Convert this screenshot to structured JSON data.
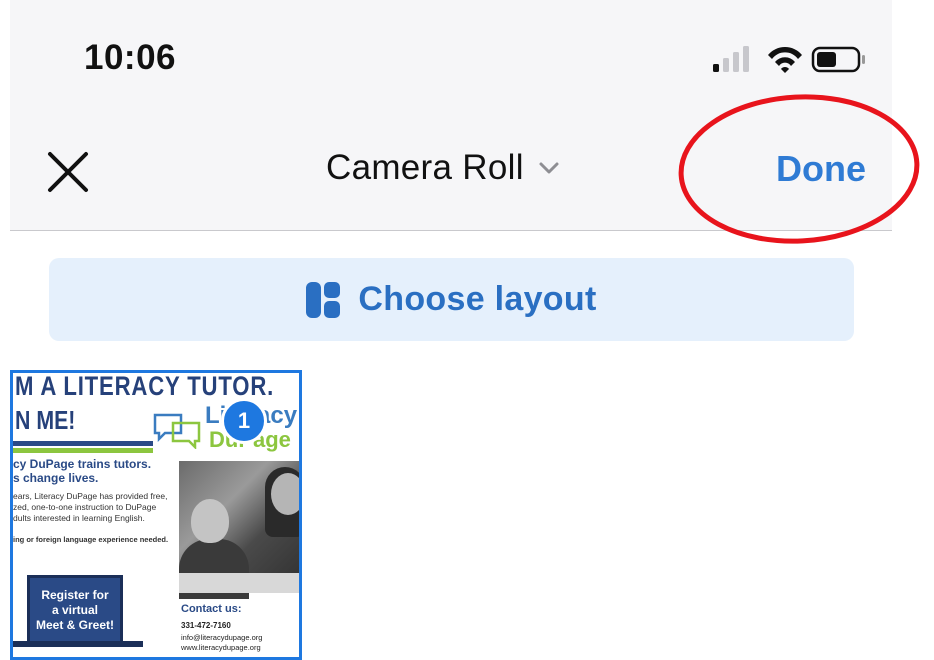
{
  "status_bar": {
    "time": "10:06",
    "icons": [
      "cellular-signal-icon",
      "wifi-icon",
      "battery-icon"
    ]
  },
  "nav": {
    "close_icon": "close-icon",
    "title": "Camera Roll",
    "title_chevron": "chevron-down-icon",
    "done_label": "Done"
  },
  "layout_button": {
    "icon": "layout-grid-icon",
    "label": "Choose layout"
  },
  "photos": [
    {
      "selected": true,
      "selection_number": "1",
      "flyer": {
        "title_line1": "M A LITERACY TUTOR.",
        "title_line2": "N ME!",
        "logo_line1": "Literacy",
        "logo_line2": "DuPage",
        "subtitle_line1": "cy DuPage trains tutors.",
        "subtitle_line2": "s change lives.",
        "body_line1": "ears, Literacy DuPage has provided free,",
        "body_line2": "zed, one-to-one instruction to DuPage",
        "body_line3": "dults interested in learning English.",
        "note": "ing or foreign language experience needed.",
        "register_line1": "Register for",
        "register_line2": "a virtual",
        "register_line3": "Meet & Greet!",
        "contact_title": "Contact us:",
        "contact_phone": "331-472-7160",
        "contact_email": "info@literacydupage.org",
        "contact_web": "www.literacydupage.org"
      }
    }
  ],
  "colors": {
    "accent": "#2f7bd4",
    "layout_button_bg": "#e5f0fc",
    "selection_badge": "#1e78e0",
    "annotation_circle": "#e8141c"
  }
}
